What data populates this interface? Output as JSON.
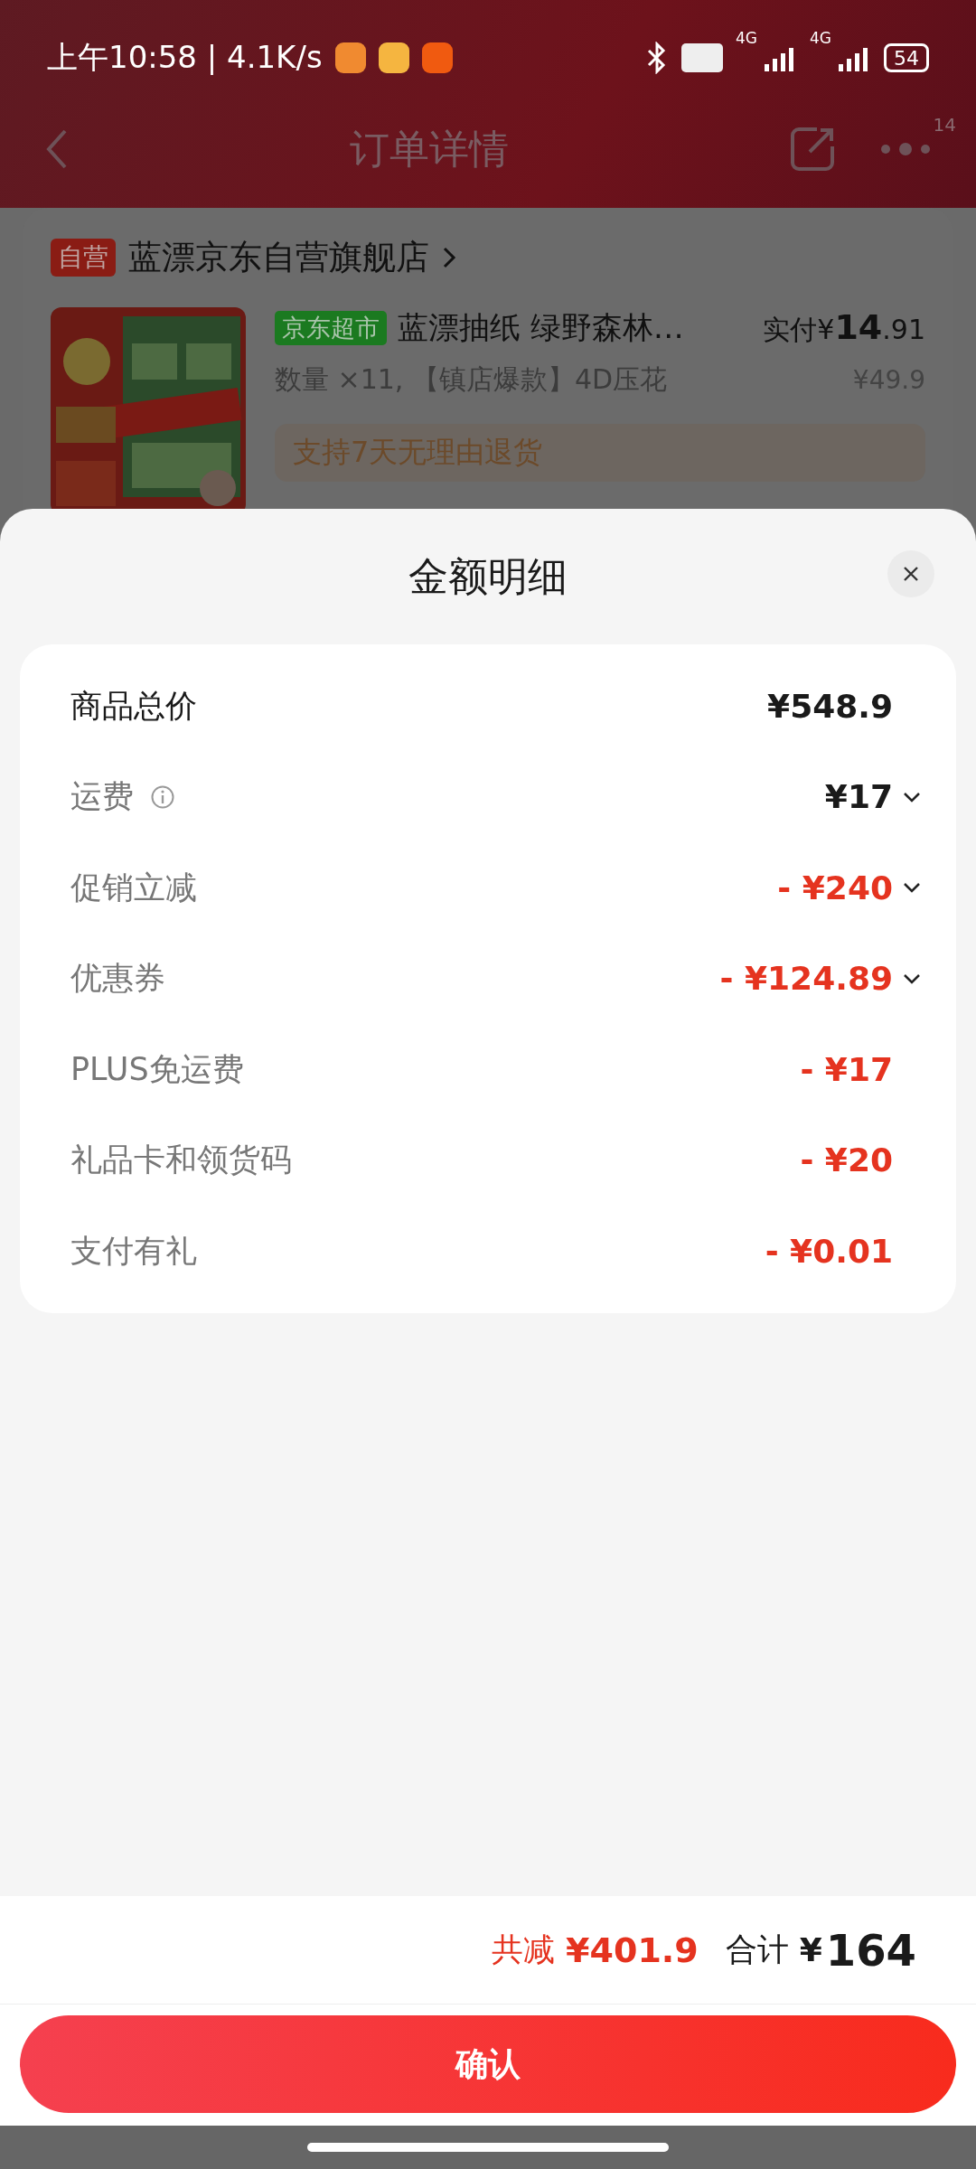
{
  "status_bar": {
    "time": "上午10:58 | 4.1K/s",
    "network": [
      "4G",
      "4G"
    ],
    "battery": "54"
  },
  "header": {
    "title": "订单详情",
    "badge": "14"
  },
  "store": {
    "tag": "自营",
    "name": "蓝漂京东自营旗舰店"
  },
  "product": {
    "kind": "picture",
    "tag": "京东超市",
    "name": "蓝漂抽纸 绿野森林…",
    "paid_label": "实付",
    "price_currency": "¥",
    "price_integer": "14",
    "price_decimal": ".91",
    "original_price": "¥49.9",
    "spec": "数量 ×11, 【镇店爆款】4D压花",
    "promo": "支持7天无理由退货"
  },
  "sheet": {
    "title": "金额明细",
    "rows": [
      {
        "label": "商品总价",
        "value": "¥548.9",
        "kind": "total",
        "info": false,
        "expandable": false
      },
      {
        "label": "运费",
        "value": "¥17",
        "kind": "charge",
        "info": true,
        "expandable": true
      },
      {
        "label": "促销立减",
        "value": "- ¥240",
        "kind": "discount",
        "info": false,
        "expandable": true
      },
      {
        "label": "优惠券",
        "value": "- ¥124.89",
        "kind": "discount",
        "info": false,
        "expandable": true
      },
      {
        "label": "PLUS免运费",
        "value": "- ¥17",
        "kind": "discount",
        "info": false,
        "expandable": false
      },
      {
        "label": "礼品卡和领货码",
        "value": "- ¥20",
        "kind": "discount",
        "info": false,
        "expandable": false
      },
      {
        "label": "支付有礼",
        "value": "- ¥0.01",
        "kind": "discount",
        "info": false,
        "expandable": false
      }
    ]
  },
  "summary": {
    "discount_label": "共减",
    "discount_value": "¥401.9",
    "total_label": "合计",
    "total_currency": "¥",
    "total_value": "164"
  },
  "confirm_button": "确认"
}
